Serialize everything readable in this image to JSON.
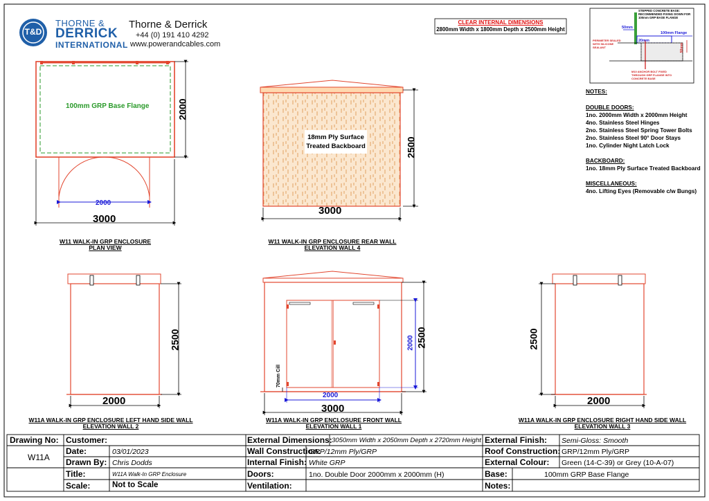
{
  "header": {
    "logo_badge": "T&D",
    "logo_line1": "THORNE &",
    "logo_line2": "DERRICK",
    "logo_line3": "INTERNATIONAL",
    "company": "Thorne & Derrick",
    "phone": "+44 (0) 191 410 4292",
    "website": "www.powerandcables.com"
  },
  "clear_dims": {
    "title": "CLEAR INTERNAL DIMENSIONS",
    "value": "2800mm Width x 1800mm Depth x 2500mm Height"
  },
  "detail": {
    "title": "STEPPED CONCRETE BASE: RECOMMENDED FIXING DOWN FOR 100mm GRP BASE FLANGE",
    "dim_50": "50mm",
    "dim_flange": "100mm Flange",
    "dim_20": "20mm",
    "dim_50b": "50mm",
    "perimeter": "PERIMETER SEALED WITH SILICONE SEALANT",
    "anchor": "M10 ANCHOR BOLT FIXED THROUGH GRP FLANGE INTO CONCRETE BASE"
  },
  "notes": {
    "title": "NOTES:",
    "doors_title": "DOUBLE DOORS:",
    "doors": [
      "1no. 2000mm Width x 2000mm Height",
      "4no. Stainless Steel Hinges",
      "2no. Stainless Steel Spring Tower Bolts",
      "2no. Stainless Steel 90° Door Stays",
      "1no. Cylinder Night Latch Lock"
    ],
    "backboard_title": "BACKBOARD:",
    "backboard": [
      "1no. 18mm Ply Surface Treated Backboard"
    ],
    "misc_title": "MISCELLANEOUS:",
    "misc": [
      "4no. Lifting Eyes (Removable c/w Bungs)"
    ]
  },
  "plan": {
    "flange_label": "100mm GRP Base Flange",
    "dim_depth": "2000",
    "dim_door": "2000",
    "dim_width": "3000",
    "caption": [
      "W11 WALK-IN GRP ENCLOSURE",
      "PLAN VIEW"
    ]
  },
  "rear": {
    "board_label": [
      "18mm Ply Surface",
      "Treated Backboard"
    ],
    "dim_height": "2500",
    "dim_width": "3000",
    "caption": [
      "W11 WALK-IN GRP ENCLOSURE REAR WALL",
      "ELEVATION WALL 4"
    ]
  },
  "left": {
    "dim_height": "2500",
    "dim_width": "2000",
    "caption": [
      "W11A WALK-IN GRP ENCLOSURE LEFT HAND SIDE WALL",
      "ELEVATION WALL 2"
    ]
  },
  "front": {
    "dim_door_h": "2000",
    "dim_height": "2500",
    "dim_cill": "70mm Cill",
    "dim_door_w": "2000",
    "dim_width": "3000",
    "caption": [
      "W11A WALK-IN GRP ENCLOSURE FRONT WALL",
      "ELEVATION WALL 1"
    ]
  },
  "right": {
    "dim_height": "2500",
    "dim_width": "2000",
    "caption": [
      "W11A WALK-IN GRP ENCLOSURE RIGHT HAND SIDE WALL",
      "ELEVATION WALL 3"
    ]
  },
  "title_block": {
    "drawing_no_label": "Drawing No:",
    "drawing_no": "W11A",
    "customer_label": "Customer:",
    "customer": "",
    "date_label": "Date:",
    "date": "03/01/2023",
    "drawn_by_label": "Drawn By:",
    "drawn_by": "Chris Dodds",
    "title_label": "Title:",
    "title": "W11A Walk-In GRP Enclosure",
    "scale_label": "Scale:",
    "scale": "Not to Scale",
    "ext_dims_label": "External Dimensions:",
    "ext_dims": "3050mm Width x 2050mm Depth x 2720mm Height",
    "wall_label": "Wall Construction:",
    "wall": "GRP/12mm Ply/GRP",
    "int_finish_label": "Internal Finish:",
    "int_finish": "White GRP",
    "doors_label": "Doors:",
    "doors": "1no. Double Door 2000mm x 2000mm (H)",
    "vent_label": "Ventilation:",
    "vent": "",
    "ext_finish_label": "External Finish:",
    "ext_finish": "Semi-Gloss: Smooth",
    "roof_label": "Roof Construction:",
    "roof": "GRP/12mm Ply/GRP",
    "ext_colour_label": "External Colour:",
    "ext_colour": "Green (14-C-39) or Grey (10-A-07)",
    "base_label": "Base:",
    "base": "100mm GRP Base Flange",
    "notes_label": "Notes:",
    "notes": ""
  },
  "colors": {
    "enclosure": "#e2462e",
    "flange": "#ff9a3c",
    "dim_blue": "#1a1ad8",
    "green": "#2a9a2a",
    "brand_blue": "#1f5fa8",
    "ply": "#e8b47a"
  }
}
